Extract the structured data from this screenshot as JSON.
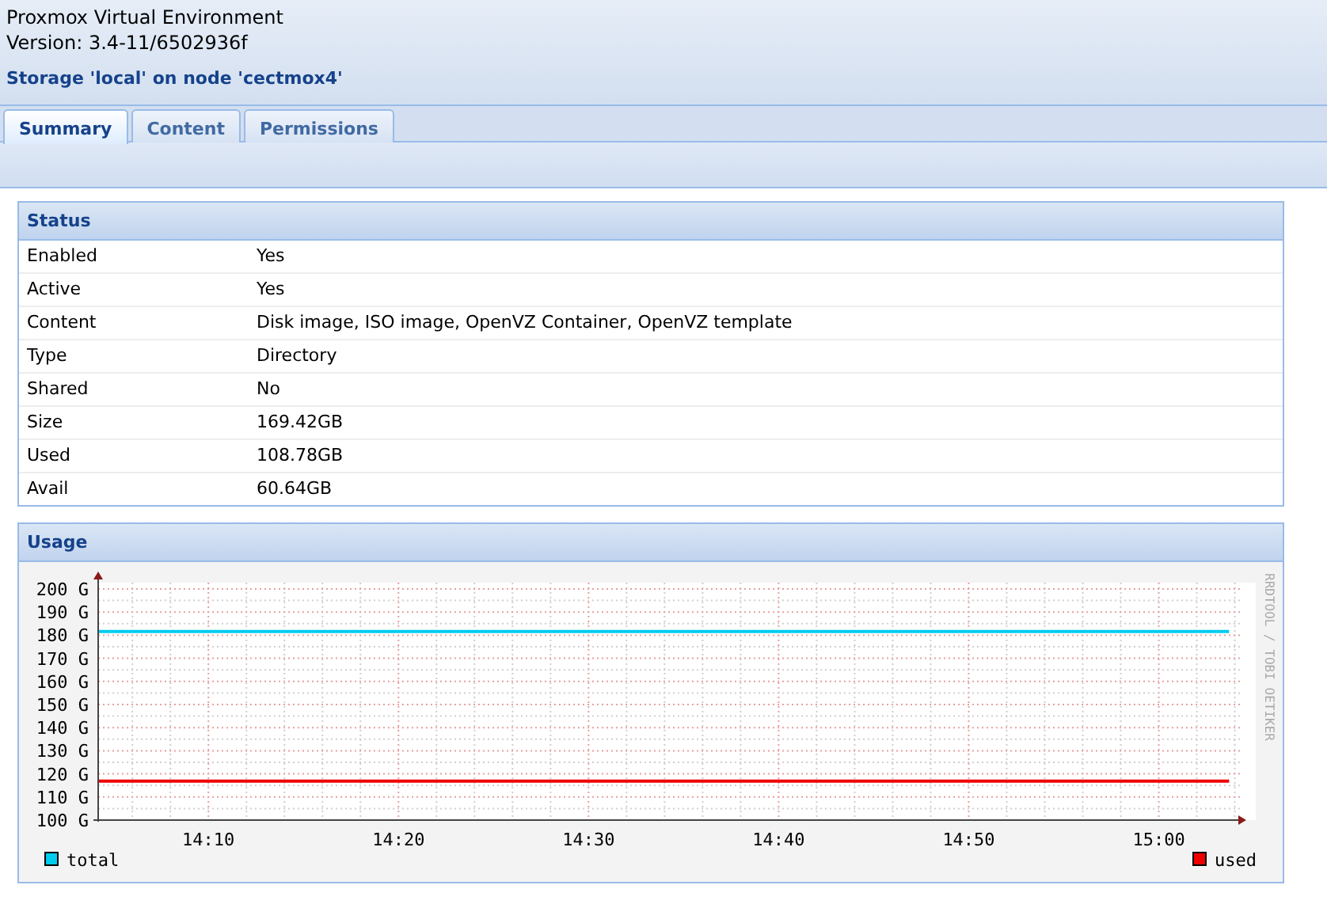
{
  "header": {
    "product": "Proxmox Virtual Environment",
    "version": "Version: 3.4-11/6502936f",
    "title": "Storage 'local' on node 'cectmox4'"
  },
  "tabs": [
    {
      "label": "Summary",
      "selected": true
    },
    {
      "label": "Content",
      "selected": false
    },
    {
      "label": "Permissions",
      "selected": false
    }
  ],
  "status": {
    "title": "Status",
    "rows": [
      {
        "label": "Enabled",
        "value": "Yes"
      },
      {
        "label": "Active",
        "value": "Yes"
      },
      {
        "label": "Content",
        "value": "Disk image, ISO image, OpenVZ Container, OpenVZ template"
      },
      {
        "label": "Type",
        "value": "Directory"
      },
      {
        "label": "Shared",
        "value": "No"
      },
      {
        "label": "Size",
        "value": "169.42GB"
      },
      {
        "label": "Used",
        "value": "108.78GB"
      },
      {
        "label": "Avail",
        "value": "60.64GB"
      }
    ]
  },
  "usage": {
    "title": "Usage",
    "credit": "RRDTOOL / TOBI OETIKER",
    "chart_data": {
      "type": "line",
      "x": [
        844.2,
        903.7
      ],
      "series": [
        {
          "name": "total",
          "color": "#00ccee",
          "values": [
            181.6,
            181.6
          ]
        },
        {
          "name": "used",
          "color": "#ee0000",
          "values": [
            116.9,
            116.9
          ]
        }
      ],
      "xlim": [
        844.2,
        904.6
      ],
      "ylim": [
        100,
        200
      ],
      "grid": true,
      "legend": true,
      "xticks": [
        {
          "value": 850,
          "label": "14:10"
        },
        {
          "value": 860,
          "label": "14:20"
        },
        {
          "value": 870,
          "label": "14:30"
        },
        {
          "value": 880,
          "label": "14:40"
        },
        {
          "value": 890,
          "label": "14:50"
        },
        {
          "value": 900,
          "label": "15:00"
        }
      ],
      "yticks": [
        {
          "value": 100,
          "label": "100 G"
        },
        {
          "value": 110,
          "label": "110 G"
        },
        {
          "value": 120,
          "label": "120 G"
        },
        {
          "value": 130,
          "label": "130 G"
        },
        {
          "value": 140,
          "label": "140 G"
        },
        {
          "value": 150,
          "label": "150 G"
        },
        {
          "value": 160,
          "label": "160 G"
        },
        {
          "value": 170,
          "label": "170 G"
        },
        {
          "value": 180,
          "label": "180 G"
        },
        {
          "value": 190,
          "label": "190 G"
        },
        {
          "value": 200,
          "label": "200 G"
        }
      ]
    }
  }
}
